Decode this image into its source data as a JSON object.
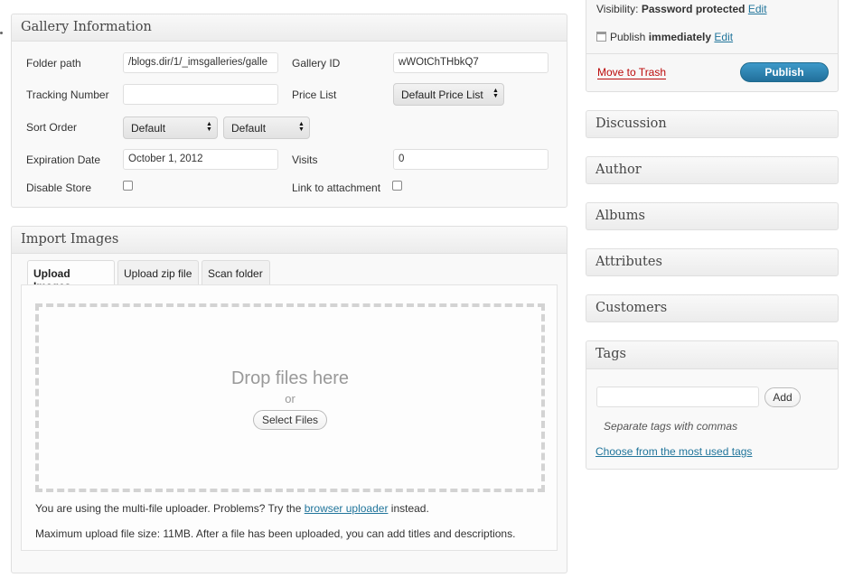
{
  "gallery_info": {
    "title": "Gallery Information",
    "folder_path_label": "Folder path",
    "folder_path_value": "/blogs.dir/1/_imsgalleries/galle",
    "gallery_id_label": "Gallery ID",
    "gallery_id_value": "wWOtChTHbkQ7",
    "tracking_number_label": "Tracking Number",
    "tracking_number_value": "",
    "price_list_label": "Price List",
    "price_list_value": "Default Price List",
    "sort_order_label": "Sort Order",
    "sort_order_value_1": "Default",
    "sort_order_value_2": "Default",
    "expiration_label": "Expiration Date",
    "expiration_value": "October 1, 2012",
    "visits_label": "Visits",
    "visits_value": "0",
    "disable_store_label": "Disable Store",
    "link_attachment_label": "Link to attachment"
  },
  "import_images": {
    "title": "Import Images",
    "tabs": [
      {
        "label": "Upload Images"
      },
      {
        "label": "Upload zip file"
      },
      {
        "label": "Scan folder"
      }
    ],
    "drop_text": "Drop files here",
    "or_text": "or",
    "select_files": "Select Files",
    "uploader_note_prefix": "You are using the multi-file uploader. Problems? Try the ",
    "uploader_note_link": "browser uploader",
    "uploader_note_suffix": " instead.",
    "max_size_note": "Maximum upload file size: 11MB. After a file has been uploaded, you can add titles and descriptions."
  },
  "publish": {
    "visibility_label": "Visibility:",
    "visibility_value": "Password protected",
    "visibility_edit": "Edit",
    "publish_label": "Publish",
    "publish_value": "immediately",
    "publish_edit": "Edit",
    "trash": "Move to Trash",
    "publish_button": "Publish"
  },
  "side_panels": {
    "discussion": "Discussion",
    "author": "Author",
    "albums": "Albums",
    "attributes": "Attributes",
    "customers": "Customers"
  },
  "tags": {
    "title": "Tags",
    "input_value": "",
    "add_button": "Add",
    "hint": "Separate tags with commas",
    "choose_link": "Choose from the most used tags"
  },
  "colors": {
    "link": "#21759b",
    "publish_button": "#2a87b6",
    "trash": "#bc0b0b"
  },
  "icons": {
    "calendar": "calendar-icon",
    "select_arrow": "updown-arrows-icon"
  }
}
